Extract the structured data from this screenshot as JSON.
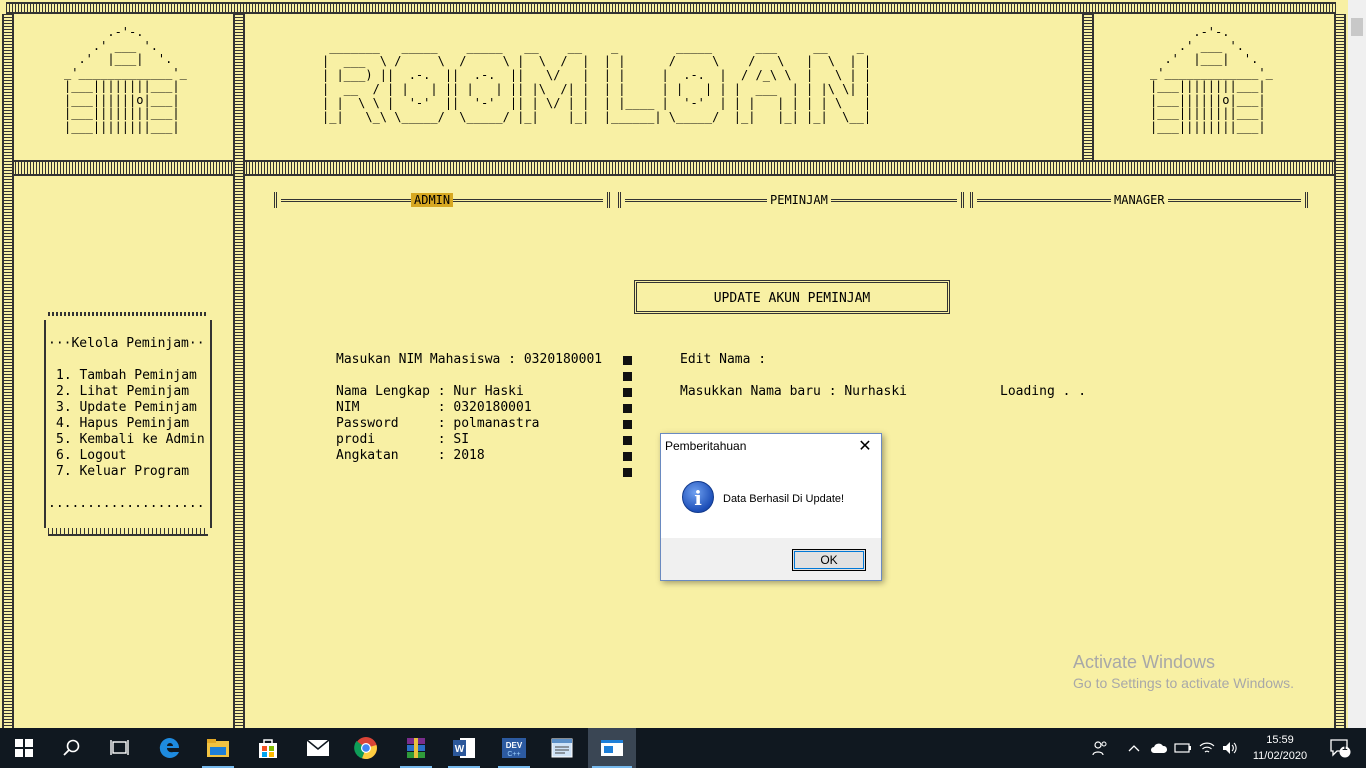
{
  "logo": {
    "ascii": " _______   _____    _____   __    __    _        _____      ___     __    _\n|  ___  \\ /     \\  /     \\ |  \\  /  |  | |      /     \\    /   \\   |  \\  | |\n| |___) ||  .-.  ||  .-.  ||   \\/   |  | |     |  .-.  |  / /_\\ \\  |   \\ | |\n|  __  / | |   | || |   | || |\\  /| |  | |     | |   | | |  ___  | | |\\ \\| |\n| |  \\ \\ |  '-'  ||  '-'  || | \\/ | |  | |____ |  '-'  | | |   | | | | \\   |\n|_|   \\_\\ \\_____/  \\_____/ |_|    |_|  |______| \\_____/  |_|   |_| |_|  \\__|"
  },
  "house_ascii": "      .-'-.\n    .' ___ '.\n  .'  |___|  '.\n_'_____________'_\n|___||||||||___|\n|___||||||o|___|\n|___||||||||___|\n|___||||||||___|",
  "tabs": [
    {
      "label": "ADMIN",
      "active": true
    },
    {
      "label": "PEMINJAM",
      "active": false
    },
    {
      "label": "MANAGER",
      "active": false
    }
  ],
  "section_title": "UPDATE AKUN PEMINJAM",
  "menu": {
    "heading": "···Kelola Peminjam··",
    "items": [
      "1. Tambah Peminjam",
      "2. Lihat Peminjam",
      "3. Update Peminjam",
      "4. Hapus Peminjam",
      "5. Kembali ke Admin",
      "6. Logout",
      "7. Keluar Program"
    ],
    "footer": "...................."
  },
  "form": {
    "nim_prompt": "Masukan NIM Mahasiswa : 0320180001",
    "fields": [
      "Nama Lengkap : Nur Haski",
      "NIM          : 0320180001",
      "Password     : polmanastra",
      "prodi        : SI",
      "Angkatan     : 2018"
    ],
    "edit_label": "Edit Nama :",
    "new_name": "Masukkan Nama baru : Nurhaski",
    "loading": "Loading . ."
  },
  "dialog": {
    "title": "Pemberitahuan",
    "message": "Data Berhasil Di Update!",
    "ok_label": "OK",
    "close_glyph": "✕"
  },
  "watermark": {
    "line1": "Activate Windows",
    "line2": "Go to Settings to activate Windows."
  },
  "taskbar": {
    "time": "15:59",
    "date": "11/02/2020",
    "notification_count": "1",
    "apps": [
      "start",
      "search",
      "task-view",
      "edge",
      "file-explorer",
      "store",
      "mail",
      "chrome",
      "winrar",
      "word",
      "devcpp",
      "notepad",
      "console"
    ]
  },
  "colors": {
    "console_bg": "#f8f0a4",
    "active_tab": "#d7a821",
    "taskbar": "#101820"
  }
}
